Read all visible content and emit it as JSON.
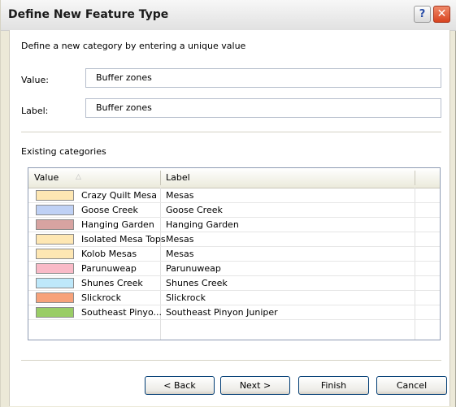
{
  "window": {
    "title": "Define New Feature Type",
    "help_glyph": "?",
    "close_glyph": "✕"
  },
  "form": {
    "description": "Define a new category by entering a unique value",
    "value_label": "Value:",
    "value": "Buffer zones",
    "label_label": "Label:",
    "label": "Buffer zones"
  },
  "categories": {
    "section_label": "Existing categories",
    "columns": [
      "Value",
      "Label"
    ],
    "sort_indicator": "△",
    "rows": [
      {
        "value": "Crazy Quilt Mesa",
        "label": "Mesas",
        "color": "#FEE7B3"
      },
      {
        "value": "Goose Creek",
        "label": "Goose Creek",
        "color": "#BFD1F5"
      },
      {
        "value": "Hanging Garden",
        "label": "Hanging Garden",
        "color": "#D7A3A1"
      },
      {
        "value": "Isolated Mesa Tops",
        "label": "Mesas",
        "color": "#FEE7B3"
      },
      {
        "value": "Kolob Mesas",
        "label": "Mesas",
        "color": "#FEE7B3"
      },
      {
        "value": "Parunuweap",
        "label": "Parunuweap",
        "color": "#F9BAC7"
      },
      {
        "value": "Shunes Creek",
        "label": "Shunes Creek",
        "color": "#BEE8FA"
      },
      {
        "value": "Slickrock",
        "label": "Slickrock",
        "color": "#F7A27A"
      },
      {
        "value": "Southeast Pinyo...",
        "label": "Southeast Pinyon Juniper",
        "color": "#9ACD66"
      }
    ]
  },
  "buttons": {
    "back": "< Back",
    "next": "Next >",
    "finish": "Finish",
    "cancel": "Cancel"
  }
}
